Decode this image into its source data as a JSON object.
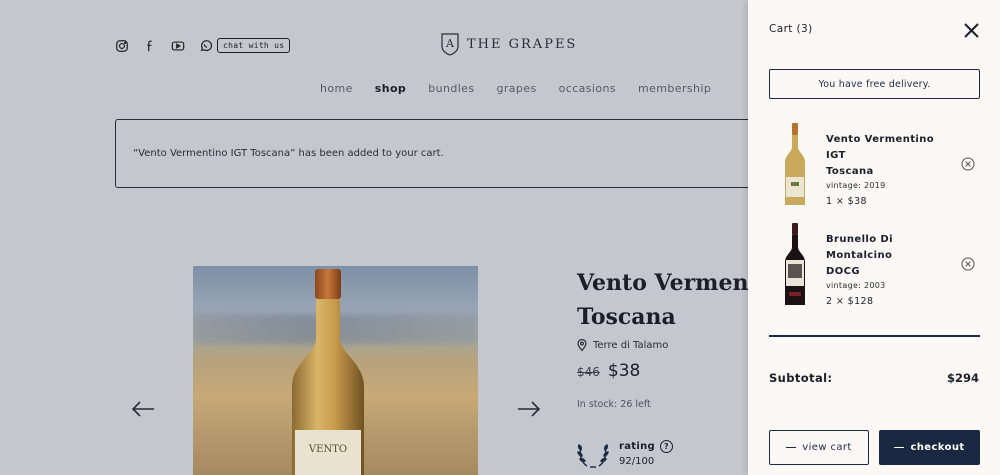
{
  "header": {
    "brand_name": "THE GRAPES",
    "brand_letter": "A",
    "chat_label": "chat with us",
    "social_icons": [
      "instagram-icon",
      "facebook-icon",
      "youtube-icon",
      "whatsapp-icon"
    ]
  },
  "nav": {
    "items": [
      {
        "label": "home"
      },
      {
        "label": "shop"
      },
      {
        "label": "bundles"
      },
      {
        "label": "grapes"
      },
      {
        "label": "occasions"
      },
      {
        "label": "membership"
      }
    ],
    "active": "shop"
  },
  "notice": {
    "text": "“Vento Vermentino IGT Toscana” has been added to your cart."
  },
  "product": {
    "title_line1": "Vento Vermentino IGT",
    "title_line2": "Toscana",
    "origin": "Terre di Talamo",
    "old_price": "$46",
    "price": "$38",
    "stock": "In stock: 26 left",
    "rating_label": "rating",
    "rating_value": "92/100",
    "bottle_label": "VENTO"
  },
  "cart": {
    "title": "Cart (3)",
    "free_delivery": "You have free delivery.",
    "items": [
      {
        "name_line1": "Vento Vermentino IGT",
        "name_line2": "Toscana",
        "vintage": "vintage: 2019",
        "qty": "1 × $38"
      },
      {
        "name_line1": "Brunello Di Montalcino",
        "name_line2": "DOCG",
        "vintage": "vintage: 2003",
        "qty": "2 × $128"
      }
    ],
    "subtotal_label": "Subtotal:",
    "subtotal_value": "$294",
    "view_cart": "view cart",
    "checkout": "checkout"
  },
  "colors": {
    "overlay": "#c4c7cd",
    "drawer_bg": "#fbf8f5",
    "navy": "#1a2740"
  }
}
